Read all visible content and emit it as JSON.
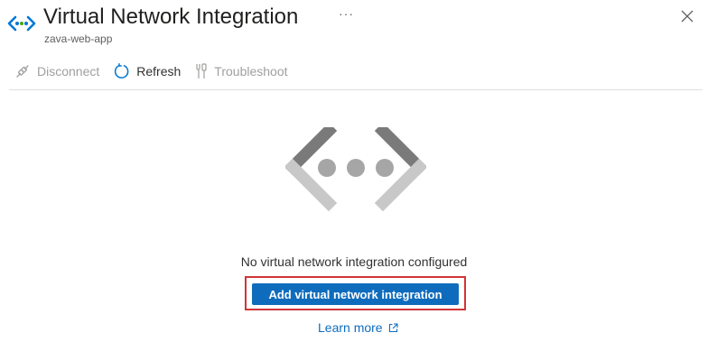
{
  "header": {
    "title": "Virtual Network Integration",
    "subtitle": "zava-web-app",
    "more_label": "···",
    "icon": "vnet-icon",
    "close_icon": "close-icon"
  },
  "toolbar": {
    "disconnect": {
      "label": "Disconnect",
      "icon": "disconnect-icon",
      "enabled": false
    },
    "refresh": {
      "label": "Refresh",
      "icon": "refresh-icon",
      "enabled": true
    },
    "troubleshoot": {
      "label": "Troubleshoot",
      "icon": "troubleshoot-icon",
      "enabled": false
    }
  },
  "empty_state": {
    "illustration": "network-placeholder-icon",
    "message": "No virtual network integration configured",
    "primary_button": "Add virtual network integration",
    "learn_more": "Learn more",
    "learn_more_icon": "external-link-icon"
  },
  "colors": {
    "accent": "#0f6cbd",
    "highlight_border": "#d13438",
    "icon_blue": "#0078d4",
    "icon_green": "#57a300",
    "disabled_text": "#a19f9d"
  }
}
